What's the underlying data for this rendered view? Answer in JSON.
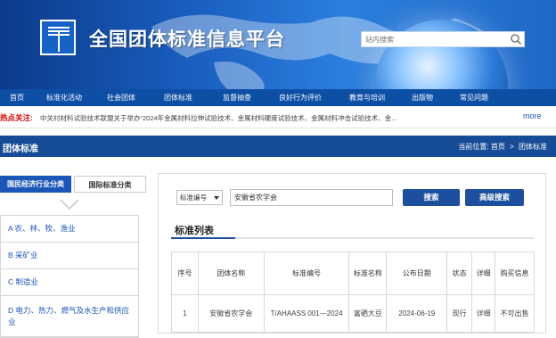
{
  "header": {
    "site_title": "全国团体标准信息平台",
    "search_placeholder": "站内搜索"
  },
  "nav": {
    "items": [
      "首页",
      "标准化活动",
      "社会团体",
      "团体标准",
      "监督抽查",
      "良好行为评价",
      "教育与培训",
      "出版物",
      "常见问题"
    ],
    "active_index": 0
  },
  "ticker": {
    "label": "热点关注:",
    "text": "中关村材料试验技术联盟关于举办“2024年金属材料拉伸试验技术、金属材料硬度试验技术、金属材料冲击试验技术、金...",
    "more": "more"
  },
  "section": {
    "title": "团体标准",
    "crumb_prefix": "当前位置:",
    "crumb_home": "首页",
    "crumb_sep": ">",
    "crumb_current": "团体标准"
  },
  "left_panel": {
    "tab_active": "国民经济行业分类",
    "tab_inactive": "国际标准分类",
    "categories": [
      "A 农、林、牧、渔业",
      "B 采矿业",
      "C 制造业",
      "D 电力、热力、燃气及水生产和供应业"
    ]
  },
  "search_form": {
    "field_select": "标准编号",
    "field_value": "安徽省农学会",
    "search_label": "搜索",
    "advanced_label": "高级搜索"
  },
  "list": {
    "title": "标准列表",
    "columns": [
      "序号",
      "团体名称",
      "标准编号",
      "标准名称",
      "公布日期",
      "状态",
      "详细",
      "购买信息"
    ],
    "rows": [
      [
        "1",
        "安徽省农学会",
        "T/AHAASS 001—2024",
        "富硒大豆",
        "2024-06-19",
        "现行",
        "详细",
        "不可出售"
      ]
    ]
  },
  "colors": {
    "nav_bg": "#0e4fa6",
    "section_bg": "#164c96",
    "accent": "#1a56b8",
    "hot_label": "#d40000"
  }
}
